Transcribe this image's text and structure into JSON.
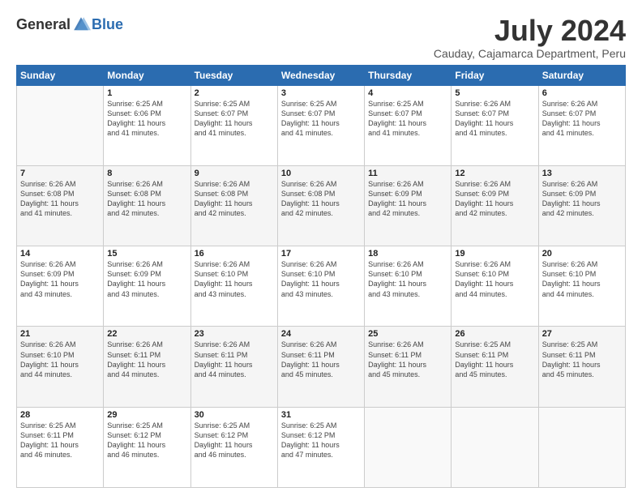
{
  "logo": {
    "general": "General",
    "blue": "Blue"
  },
  "title": {
    "month": "July 2024",
    "location": "Cauday, Cajamarca Department, Peru"
  },
  "headers": [
    "Sunday",
    "Monday",
    "Tuesday",
    "Wednesday",
    "Thursday",
    "Friday",
    "Saturday"
  ],
  "weeks": [
    [
      {
        "day": "",
        "info": ""
      },
      {
        "day": "1",
        "info": "Sunrise: 6:25 AM\nSunset: 6:06 PM\nDaylight: 11 hours\nand 41 minutes."
      },
      {
        "day": "2",
        "info": "Sunrise: 6:25 AM\nSunset: 6:07 PM\nDaylight: 11 hours\nand 41 minutes."
      },
      {
        "day": "3",
        "info": "Sunrise: 6:25 AM\nSunset: 6:07 PM\nDaylight: 11 hours\nand 41 minutes."
      },
      {
        "day": "4",
        "info": "Sunrise: 6:25 AM\nSunset: 6:07 PM\nDaylight: 11 hours\nand 41 minutes."
      },
      {
        "day": "5",
        "info": "Sunrise: 6:26 AM\nSunset: 6:07 PM\nDaylight: 11 hours\nand 41 minutes."
      },
      {
        "day": "6",
        "info": "Sunrise: 6:26 AM\nSunset: 6:07 PM\nDaylight: 11 hours\nand 41 minutes."
      }
    ],
    [
      {
        "day": "7",
        "info": "Sunrise: 6:26 AM\nSunset: 6:08 PM\nDaylight: 11 hours\nand 41 minutes."
      },
      {
        "day": "8",
        "info": "Sunrise: 6:26 AM\nSunset: 6:08 PM\nDaylight: 11 hours\nand 42 minutes."
      },
      {
        "day": "9",
        "info": "Sunrise: 6:26 AM\nSunset: 6:08 PM\nDaylight: 11 hours\nand 42 minutes."
      },
      {
        "day": "10",
        "info": "Sunrise: 6:26 AM\nSunset: 6:08 PM\nDaylight: 11 hours\nand 42 minutes."
      },
      {
        "day": "11",
        "info": "Sunrise: 6:26 AM\nSunset: 6:09 PM\nDaylight: 11 hours\nand 42 minutes."
      },
      {
        "day": "12",
        "info": "Sunrise: 6:26 AM\nSunset: 6:09 PM\nDaylight: 11 hours\nand 42 minutes."
      },
      {
        "day": "13",
        "info": "Sunrise: 6:26 AM\nSunset: 6:09 PM\nDaylight: 11 hours\nand 42 minutes."
      }
    ],
    [
      {
        "day": "14",
        "info": "Sunrise: 6:26 AM\nSunset: 6:09 PM\nDaylight: 11 hours\nand 43 minutes."
      },
      {
        "day": "15",
        "info": "Sunrise: 6:26 AM\nSunset: 6:09 PM\nDaylight: 11 hours\nand 43 minutes."
      },
      {
        "day": "16",
        "info": "Sunrise: 6:26 AM\nSunset: 6:10 PM\nDaylight: 11 hours\nand 43 minutes."
      },
      {
        "day": "17",
        "info": "Sunrise: 6:26 AM\nSunset: 6:10 PM\nDaylight: 11 hours\nand 43 minutes."
      },
      {
        "day": "18",
        "info": "Sunrise: 6:26 AM\nSunset: 6:10 PM\nDaylight: 11 hours\nand 43 minutes."
      },
      {
        "day": "19",
        "info": "Sunrise: 6:26 AM\nSunset: 6:10 PM\nDaylight: 11 hours\nand 44 minutes."
      },
      {
        "day": "20",
        "info": "Sunrise: 6:26 AM\nSunset: 6:10 PM\nDaylight: 11 hours\nand 44 minutes."
      }
    ],
    [
      {
        "day": "21",
        "info": "Sunrise: 6:26 AM\nSunset: 6:10 PM\nDaylight: 11 hours\nand 44 minutes."
      },
      {
        "day": "22",
        "info": "Sunrise: 6:26 AM\nSunset: 6:11 PM\nDaylight: 11 hours\nand 44 minutes."
      },
      {
        "day": "23",
        "info": "Sunrise: 6:26 AM\nSunset: 6:11 PM\nDaylight: 11 hours\nand 44 minutes."
      },
      {
        "day": "24",
        "info": "Sunrise: 6:26 AM\nSunset: 6:11 PM\nDaylight: 11 hours\nand 45 minutes."
      },
      {
        "day": "25",
        "info": "Sunrise: 6:26 AM\nSunset: 6:11 PM\nDaylight: 11 hours\nand 45 minutes."
      },
      {
        "day": "26",
        "info": "Sunrise: 6:25 AM\nSunset: 6:11 PM\nDaylight: 11 hours\nand 45 minutes."
      },
      {
        "day": "27",
        "info": "Sunrise: 6:25 AM\nSunset: 6:11 PM\nDaylight: 11 hours\nand 45 minutes."
      }
    ],
    [
      {
        "day": "28",
        "info": "Sunrise: 6:25 AM\nSunset: 6:11 PM\nDaylight: 11 hours\nand 46 minutes."
      },
      {
        "day": "29",
        "info": "Sunrise: 6:25 AM\nSunset: 6:12 PM\nDaylight: 11 hours\nand 46 minutes."
      },
      {
        "day": "30",
        "info": "Sunrise: 6:25 AM\nSunset: 6:12 PM\nDaylight: 11 hours\nand 46 minutes."
      },
      {
        "day": "31",
        "info": "Sunrise: 6:25 AM\nSunset: 6:12 PM\nDaylight: 11 hours\nand 47 minutes."
      },
      {
        "day": "",
        "info": ""
      },
      {
        "day": "",
        "info": ""
      },
      {
        "day": "",
        "info": ""
      }
    ]
  ]
}
